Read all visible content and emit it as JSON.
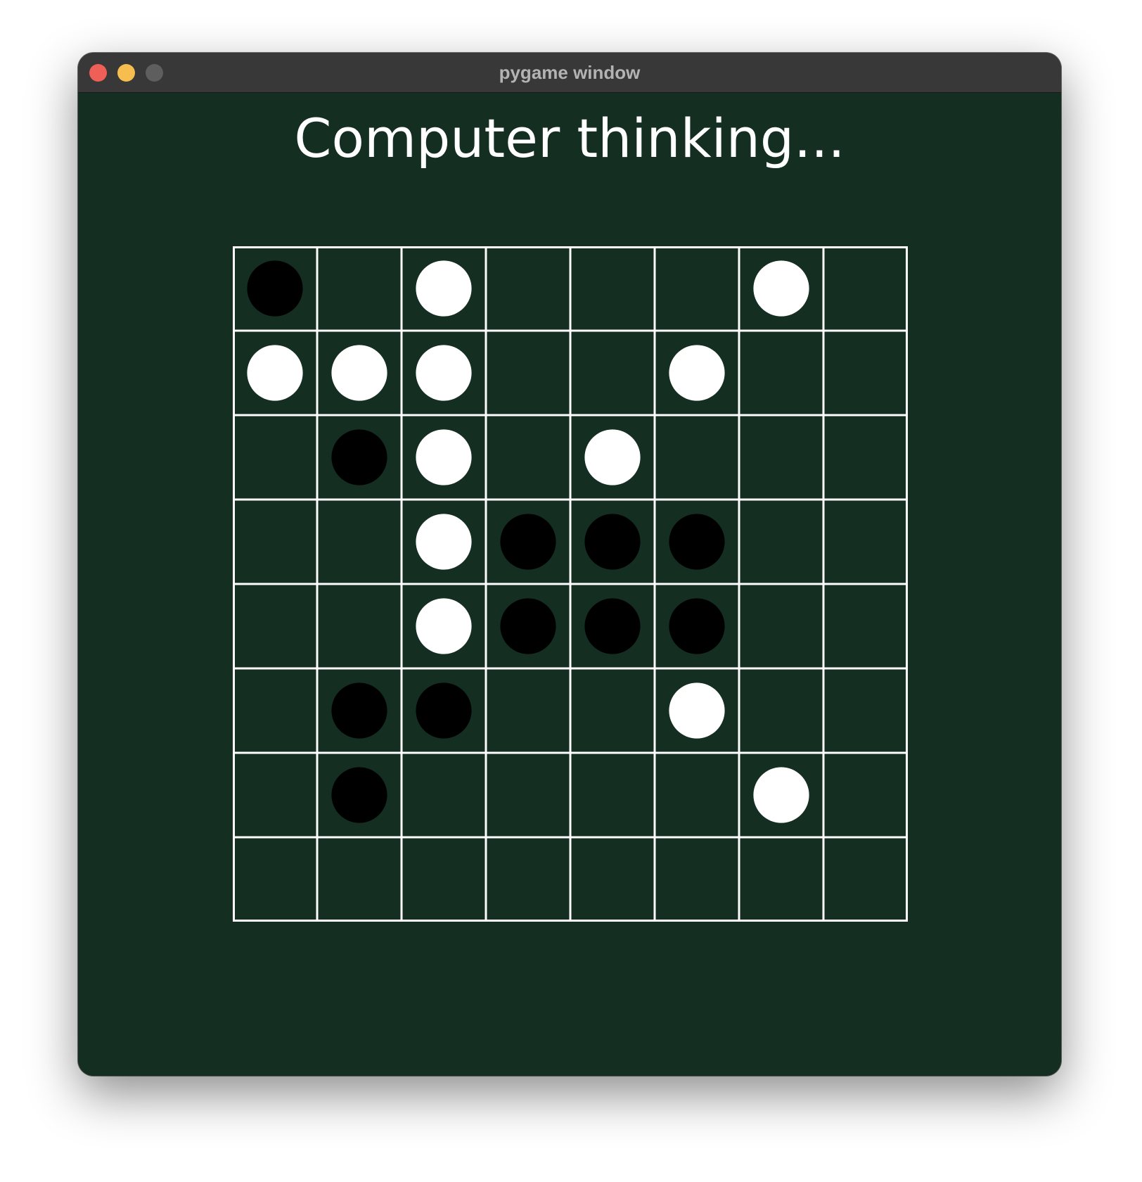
{
  "window": {
    "title": "pygame window"
  },
  "status_text": "Computer thinking...",
  "colors": {
    "background": "#142e22",
    "grid_line": "#ffffff",
    "black_piece": "#000000",
    "white_piece": "#ffffff"
  },
  "board": {
    "size": 8,
    "cells": [
      [
        "B",
        "",
        "W",
        "",
        "",
        "",
        "W",
        ""
      ],
      [
        "W",
        "W",
        "W",
        "",
        "",
        "W",
        "",
        ""
      ],
      [
        "",
        "B",
        "W",
        "",
        "W",
        "",
        "",
        ""
      ],
      [
        "",
        "",
        "W",
        "B",
        "B",
        "B",
        "",
        ""
      ],
      [
        "",
        "",
        "W",
        "B",
        "B",
        "B",
        "",
        ""
      ],
      [
        "",
        "B",
        "B",
        "",
        "",
        "W",
        "",
        ""
      ],
      [
        "",
        "B",
        "",
        "",
        "",
        "",
        "W",
        ""
      ],
      [
        "",
        "",
        "",
        "",
        "",
        "",
        "",
        ""
      ]
    ]
  }
}
